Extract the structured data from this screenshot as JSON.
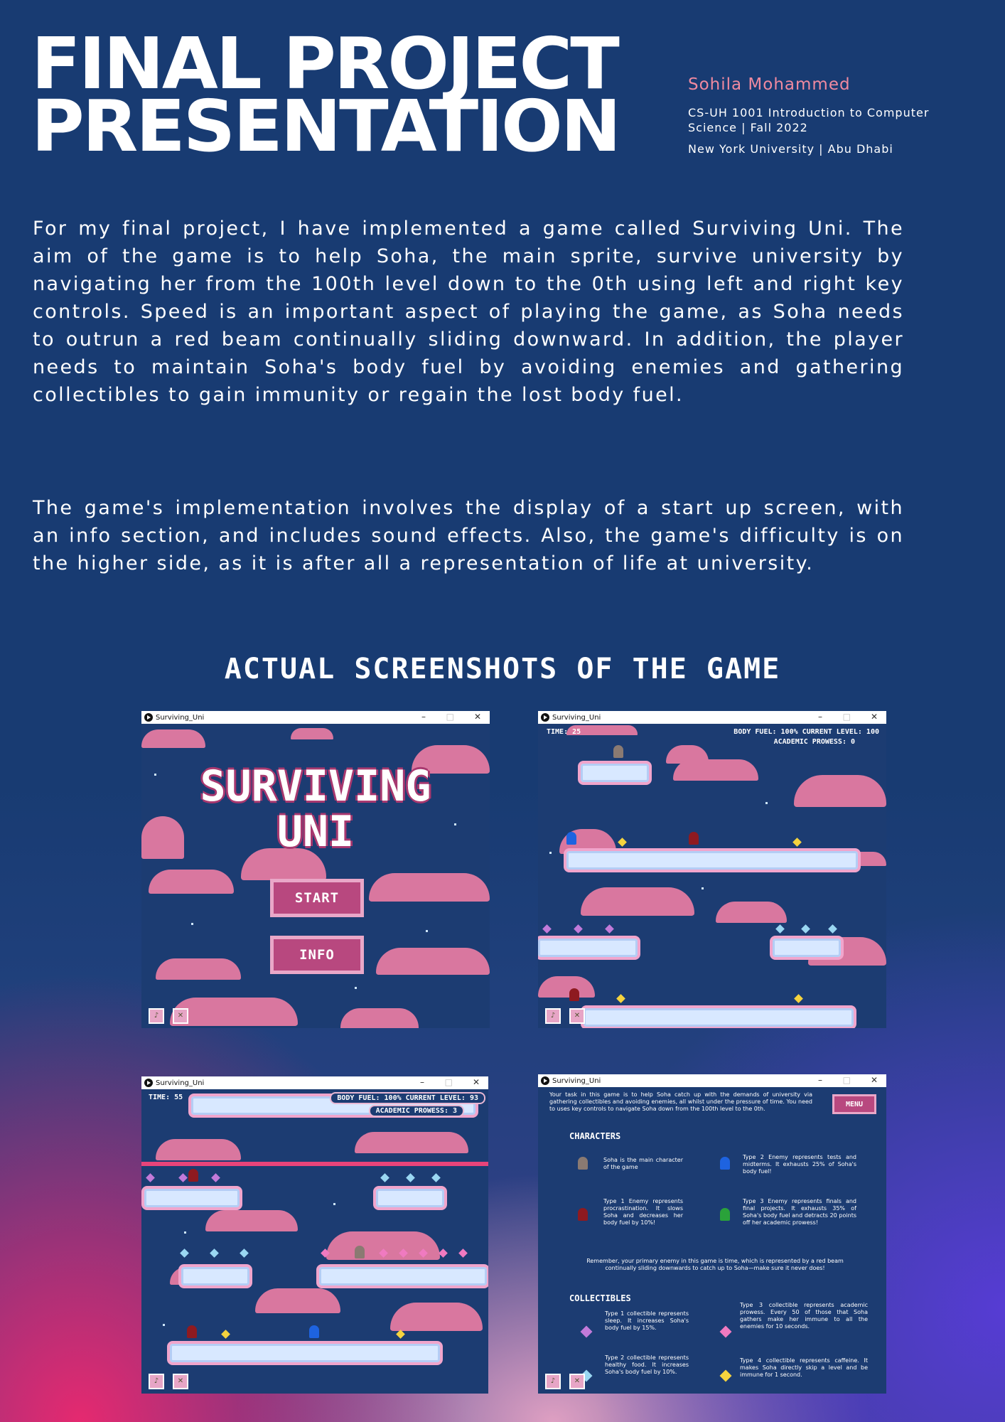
{
  "header": {
    "title_line1": "FINAL PROJECT",
    "title_line2": "PRESENTATION",
    "author": "Sohila Mohammed",
    "course": "CS-UH 1001 Introduction to Computer Science | Fall 2022",
    "university": "New York University | Abu Dhabi"
  },
  "body": {
    "paragraph1": "For my final project, I have implemented a game called Surviving Uni. The aim of the game is to help Soha, the main sprite, survive university by navigating her from the 100th level down to the 0th using left and right key controls. Speed is an important aspect of playing the game, as Soha needs to outrun a red beam continually sliding downward. In addition, the player needs to maintain Soha's body fuel by avoiding enemies and gathering collectibles to gain immunity or regain the lost body fuel.",
    "paragraph2": "The game's implementation involves the display of a start up screen, with an info section, and includes sound effects. Also, the game's difficulty is on the higher side, as it is after all a representation of life at university."
  },
  "screenshots_heading": "ACTUAL SCREENSHOTS OF THE GAME",
  "window_title": "Surviving_Uni",
  "screens": {
    "start": {
      "title_line1": "SURVIVING",
      "title_line2": "UNI",
      "start_label": "START",
      "info_label": "INFO"
    },
    "game1": {
      "time": "TIME: 25",
      "fuel_level": "BODY FUEL: 100%  CURRENT LEVEL: 100",
      "prowess": "ACADEMIC PROWESS: 0"
    },
    "game2": {
      "time": "TIME: 55",
      "fuel_level": "BODY FUEL: 100%  CURRENT LEVEL: 93",
      "prowess": "ACADEMIC PROWESS: 3"
    },
    "info": {
      "intro": "Your task in this game is to help Soha catch up with the demands of university via gathering collectibles and avoiding enemies, all whilst under the pressure of time. You need to uses key controls to navigate Soha down from the 100th level to the 0th.",
      "menu_label": "MENU",
      "characters_heading": "CHARACTERS",
      "char_soha": "Soha is the main character of the game",
      "char_enemy1": "Type 1 Enemy represents procrastination. It slows Soha and decreases her body fuel by 10%!",
      "char_enemy2": "Type 2 Enemy represents tests and midterms. It exhausts 25% of Soha's body fuel!",
      "char_enemy3": "Type 3 Enemy represents finals and final projects. It exhausts 35% of Soha's body fuel and detracts 20 points off her academic prowess!",
      "reminder": "Remember, your primary enemy in this game is time, which is represented by a red beam continually sliding downwards to catch up to Soha—make sure it never does!",
      "collectibles_heading": "COLLECTIBLES",
      "col1": "Type 1 collectible represents sleep. It increases Soha's body fuel by 15%.",
      "col2": "Type 2 collectible represents healthy food. It increases Soha's body fuel by 10%.",
      "col3": "Type 3 collectible represents academic prowess. Every 50 of those that Soha gathers make her immune to all the enemies for 10 seconds.",
      "col4": "Type 4 collectible represents caffeine. It makes Soha directly skip a level and be immune for 1 second."
    }
  },
  "colors": {
    "background": "#183b72",
    "author_pink": "#f08aa0",
    "cloud_pink": "#d9779f",
    "button_magenta": "#b8487f"
  }
}
